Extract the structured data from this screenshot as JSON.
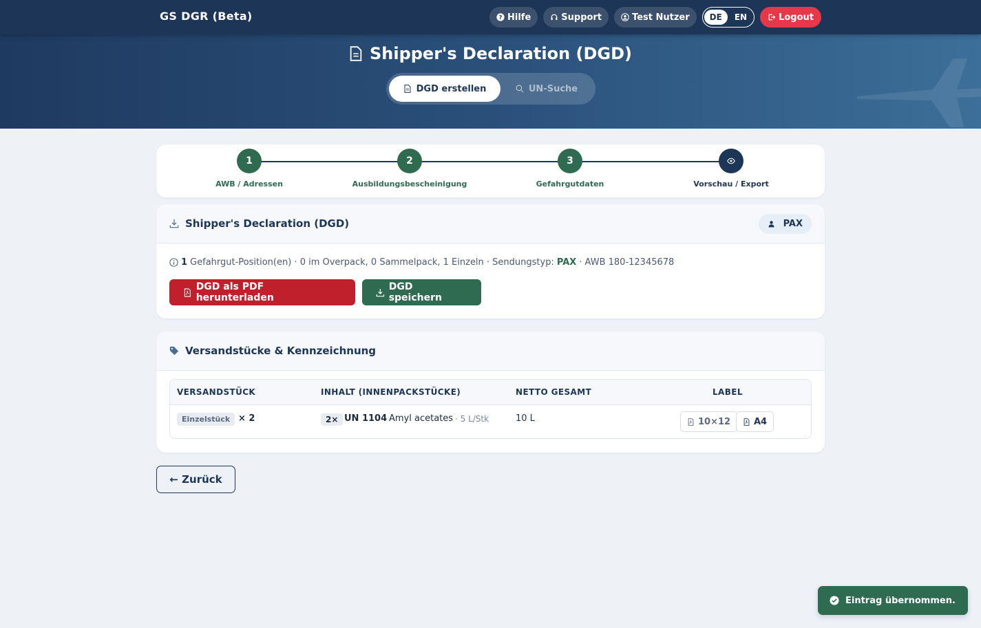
{
  "app": {
    "brand": "GS DGR (Beta)"
  },
  "nav": {
    "help": "Hilfe",
    "support": "Support",
    "user": "Test Nutzer",
    "lang_de": "DE",
    "lang_en": "EN",
    "lang_active": "DE",
    "logout": "Logout"
  },
  "hero": {
    "title": "Shipper's Declaration (DGD)",
    "tab_create": "DGD erstellen",
    "tab_search": "UN-Suche",
    "active_tab": "DGD erstellen"
  },
  "stepper": {
    "steps": [
      {
        "num": "1",
        "label": "AWB / Adressen",
        "state": "done"
      },
      {
        "num": "2",
        "label": "Ausbildungsbescheinigung",
        "state": "done"
      },
      {
        "num": "3",
        "label": "Gefahrgutdaten",
        "state": "done"
      },
      {
        "num": "",
        "label": "Vorschau / Export",
        "state": "current",
        "icon": "eye-icon"
      }
    ]
  },
  "dgd": {
    "title": "Shipper's Declaration (DGD)",
    "badge": "PAX",
    "summary": {
      "count": "1",
      "text1": "Gefahrgut-Position(en) · 0 im Overpack, 0 Sammelpack, 1 Einzeln · Sendungstyp:",
      "type": "PAX",
      "awb": "· AWB 180-12345678"
    },
    "btn_pdf": "DGD als PDF herunterladen",
    "btn_save": "DGD speichern"
  },
  "packages": {
    "title": "Versandstücke & Kennzeichnung",
    "columns": [
      "VERSANDSTÜCK",
      "INHALT (INNENPACKSTÜCKE)",
      "NETTO GESAMT",
      "LABEL"
    ],
    "rows": [
      {
        "type": "Einzelstück",
        "multiplier": "× 2",
        "qty": "2×",
        "un": "UN 1104",
        "name": "Amyl acetates",
        "per_unit": "· 5 L/Stk",
        "net": "10 L",
        "label_small": "10×12",
        "label_a4": "A4"
      }
    ]
  },
  "back": "← Zurück",
  "toast": "Eintrag übernommen.",
  "colors": {
    "navy": "#1d3557",
    "green": "#2e6b50",
    "red": "#c0202b",
    "logout": "#e5394a"
  }
}
